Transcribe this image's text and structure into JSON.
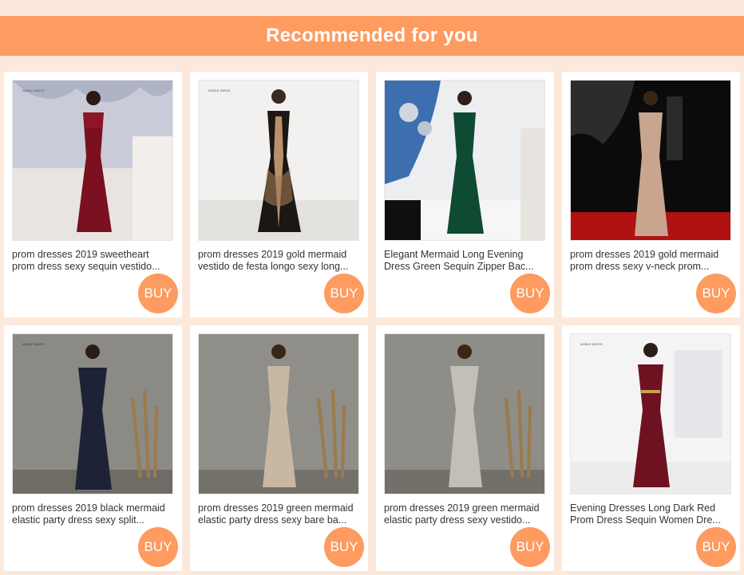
{
  "header": {
    "title": "Recommended for you"
  },
  "products": [
    {
      "title_line1": "prom dresses 2019 sweetheart",
      "title_line2": "prom dress sexy sequin vestido...",
      "buy_label": "BUY",
      "logo": "NOBLE WEISS",
      "image": "red-sequin-mermaid-dress-photo",
      "dress_color": "#7a1020",
      "bg_color": "#dcdde3"
    },
    {
      "title_line1": "prom dresses 2019 gold mermaid",
      "title_line2": "vestido de festa longo sexy long...",
      "buy_label": "BUY",
      "logo": "NOBLE WEISS",
      "image": "black-gold-mermaid-dress-photo",
      "dress_color": "#1a1714",
      "bg_color": "#f2f1ef"
    },
    {
      "title_line1": "Elegant Mermaid Long Evening",
      "title_line2": "Dress Green Sequin Zipper Bac...",
      "buy_label": "BUY",
      "logo": "",
      "image": "green-sequin-mermaid-dress-photo",
      "dress_color": "#0f4a33",
      "bg_color": "#eceef0"
    },
    {
      "title_line1": "prom dresses 2019 gold mermaid",
      "title_line2": "prom dress sexy v-neck prom...",
      "buy_label": "BUY",
      "logo": "",
      "image": "champagne-sequin-dress-photo",
      "dress_color": "#c9a58f",
      "bg_color": "#0b0b0b"
    },
    {
      "title_line1": "prom dresses 2019 black mermaid",
      "title_line2": "elastic party dress sexy split...",
      "buy_label": "BUY",
      "logo": "NOBLE WEISS",
      "image": "navy-sequin-split-dress-photo",
      "dress_color": "#1d2236",
      "bg_color": "#8b8a85"
    },
    {
      "title_line1": "prom dresses 2019 green mermaid",
      "title_line2": "elastic party dress sexy bare ba...",
      "buy_label": "BUY",
      "logo": "",
      "image": "beige-sequin-dress-photo",
      "dress_color": "#c8b7a3",
      "bg_color": "#8f8e89"
    },
    {
      "title_line1": "prom dresses 2019 green mermaid",
      "title_line2": "elastic party dress sexy vestido...",
      "buy_label": "BUY",
      "logo": "",
      "image": "silver-sequin-longsleeve-dress-photo",
      "dress_color": "#c4bfb6",
      "bg_color": "#8f8d87"
    },
    {
      "title_line1": "Evening Dresses Long Dark Red",
      "title_line2": "Prom Dress Sequin Women Dre...",
      "buy_label": "BUY",
      "logo": "NOBLE WEISS",
      "image": "dark-red-tassel-dress-photo",
      "dress_color": "#6e1222",
      "bg_color": "#f4f4f5"
    }
  ]
}
